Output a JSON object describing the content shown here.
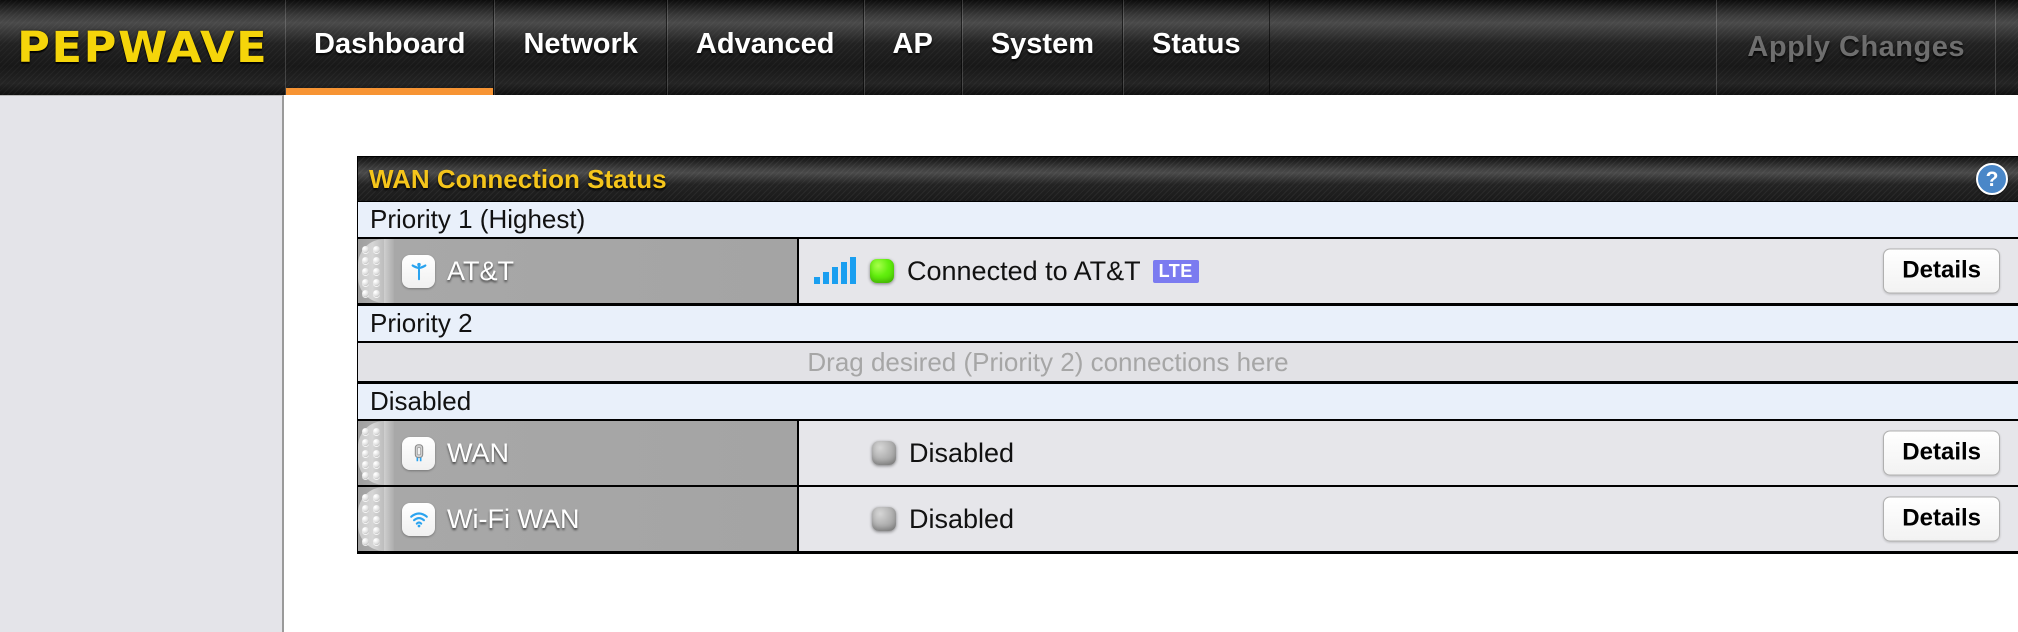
{
  "brand": {
    "logo": "PEPWAVE"
  },
  "topnav": {
    "items": [
      {
        "label": "Dashboard",
        "active": true
      },
      {
        "label": "Network",
        "active": false
      },
      {
        "label": "Advanced",
        "active": false
      },
      {
        "label": "AP",
        "active": false
      },
      {
        "label": "System",
        "active": false
      },
      {
        "label": "Status",
        "active": false
      }
    ],
    "apply_changes_label": "Apply Changes",
    "active_underline_color": "#f79433",
    "logo_color": "#f5d50a"
  },
  "panel": {
    "title": "WAN Connection Status",
    "title_color": "#f5c51b",
    "help_icon": "question-mark-icon",
    "help_icon_color": "#4a87c8",
    "groups": [
      {
        "header": "Priority 1 (Highest)",
        "rows": [
          {
            "name": "AT&T",
            "icon": "cellular-antenna-icon",
            "signal_bars": 5,
            "led": "green",
            "status": "Connected to AT&T",
            "badge": "LTE",
            "badge_color": "#7b7bf0",
            "details_label": "Details"
          }
        ]
      },
      {
        "header": "Priority 2",
        "placeholder": "Drag desired (Priority 2) connections here",
        "rows": []
      },
      {
        "header": "Disabled",
        "rows": [
          {
            "name": "WAN",
            "icon": "ethernet-plug-icon",
            "signal_bars": 0,
            "led": "gray",
            "status": "Disabled",
            "badge": "",
            "details_label": "Details"
          },
          {
            "name": "Wi-Fi WAN",
            "icon": "wifi-icon",
            "signal_bars": 0,
            "led": "gray",
            "status": "Disabled",
            "badge": "",
            "details_label": "Details"
          }
        ]
      }
    ]
  }
}
